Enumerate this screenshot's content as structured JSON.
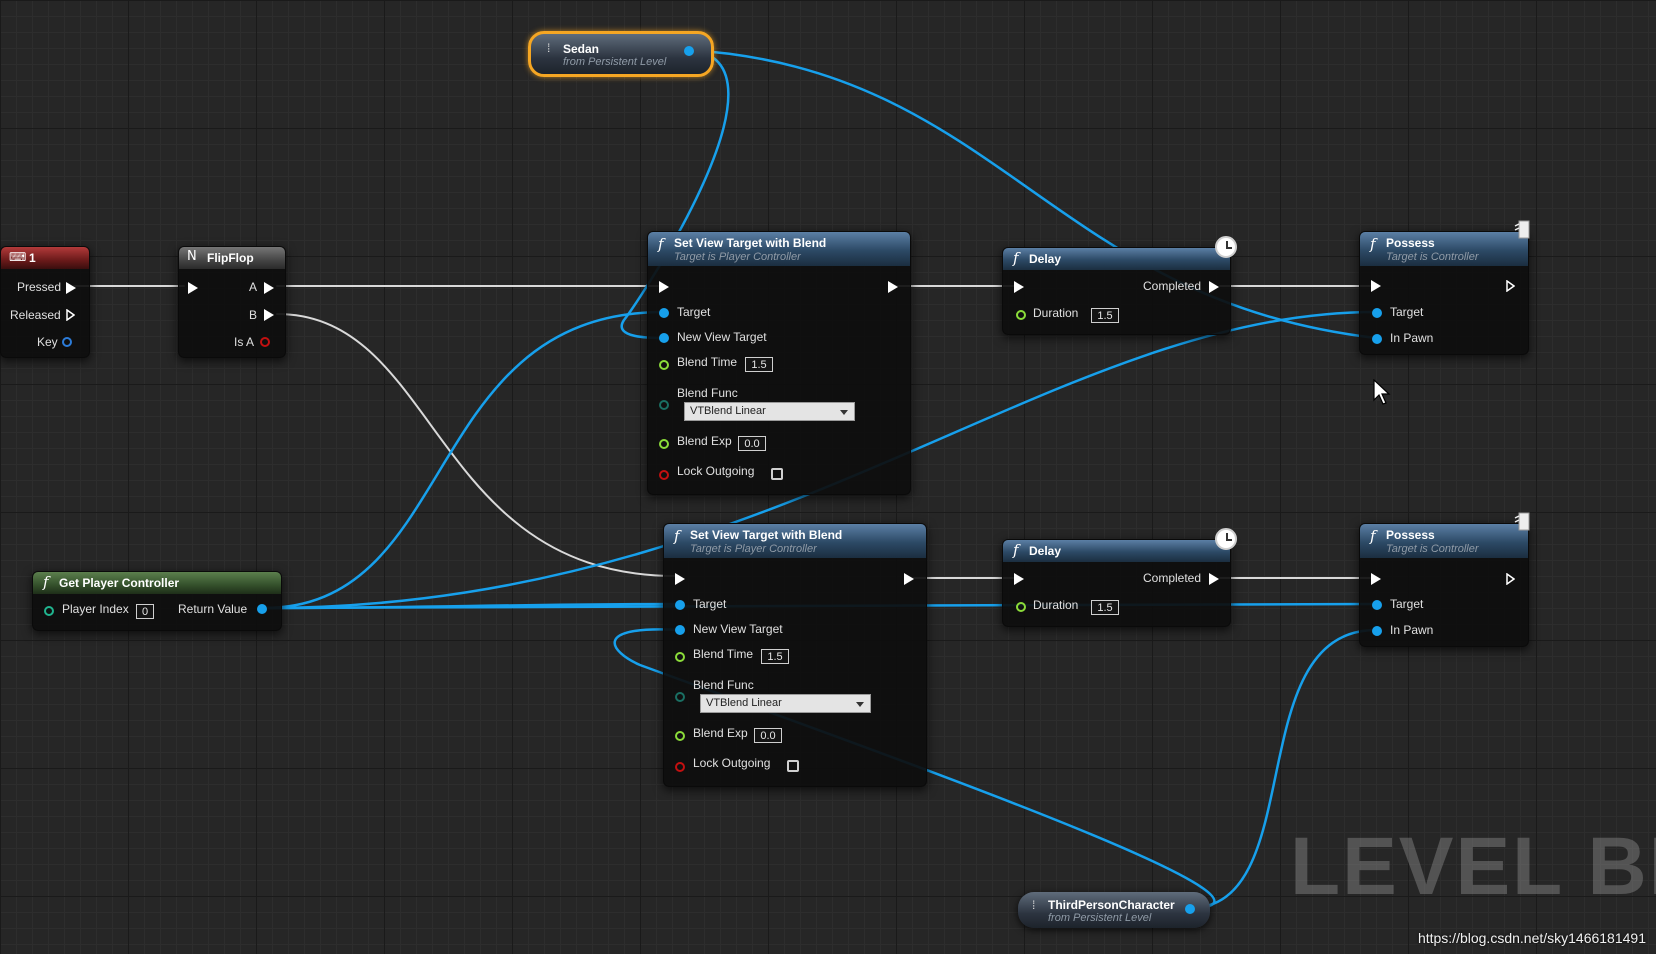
{
  "watermark": "LEVEL BL",
  "url": "https://blog.csdn.net/sky1466181491",
  "key_event": {
    "title": "1",
    "pins": {
      "pressed": "Pressed",
      "released": "Released",
      "key": "Key"
    }
  },
  "flipflop": {
    "title": "FlipFlop",
    "pins": {
      "a": "A",
      "b": "B",
      "is_a": "Is A"
    }
  },
  "sedan": {
    "title": "Sedan",
    "sub": "from Persistent Level"
  },
  "third_person": {
    "title": "ThirdPersonCharacter",
    "sub": "from Persistent Level"
  },
  "get_player_controller": {
    "title": "Get Player Controller",
    "player_index_label": "Player Index",
    "player_index_value": "0",
    "return_value": "Return Value"
  },
  "set_view_target_1": {
    "title": "Set View Target with Blend",
    "sub": "Target is Player Controller",
    "target": "Target",
    "new_view_target": "New View Target",
    "blend_time_label": "Blend Time",
    "blend_time_value": "1.5",
    "blend_func_label": "Blend Func",
    "blend_func_value": "VTBlend Linear",
    "blend_exp_label": "Blend Exp",
    "blend_exp_value": "0.0",
    "lock_outgoing": "Lock Outgoing"
  },
  "set_view_target_2": {
    "title": "Set View Target with Blend",
    "sub": "Target is Player Controller",
    "target": "Target",
    "new_view_target": "New View Target",
    "blend_time_label": "Blend Time",
    "blend_time_value": "1.5",
    "blend_func_label": "Blend Func",
    "blend_func_value": "VTBlend Linear",
    "blend_exp_label": "Blend Exp",
    "blend_exp_value": "0.0",
    "lock_outgoing": "Lock Outgoing"
  },
  "delay_1": {
    "title": "Delay",
    "completed": "Completed",
    "duration_label": "Duration",
    "duration_value": "1.5"
  },
  "delay_2": {
    "title": "Delay",
    "completed": "Completed",
    "duration_label": "Duration",
    "duration_value": "1.5"
  },
  "possess_1": {
    "title": "Possess",
    "sub": "Target is Controller",
    "target": "Target",
    "in_pawn": "In Pawn"
  },
  "possess_2": {
    "title": "Possess",
    "sub": "Target is Controller",
    "target": "Target",
    "in_pawn": "In Pawn"
  },
  "colors": {
    "object_wire": "#17a0ec",
    "exec_wire": "#d9d9d9",
    "selection": "#f5a623"
  }
}
